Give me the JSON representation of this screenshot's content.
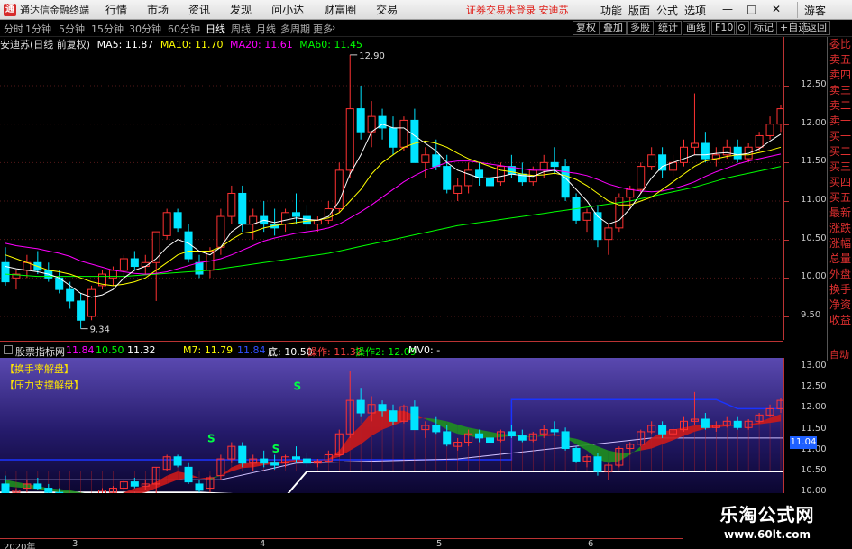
{
  "app": {
    "name": "通达信金融终端",
    "login_text": "证券交易未登录  安迪苏",
    "guest": "游客"
  },
  "menus": [
    "行情",
    "市场",
    "资讯",
    "发现",
    "问小达",
    "财富圈",
    "交易"
  ],
  "right_menus": [
    "功能",
    "版面",
    "公式",
    "选项"
  ],
  "periods": [
    "分时",
    "1分钟",
    "5分钟",
    "15分钟",
    "30分钟",
    "60分钟",
    "日线",
    "周线",
    "月线",
    "多周期",
    "更多"
  ],
  "active_period": "日线",
  "toolbar": [
    "复权",
    "叠加",
    "多股",
    "统计",
    "画线",
    "F10",
    "标记",
    "+自选",
    "返回"
  ],
  "main_header": {
    "stock": "安迪苏(日线 前复权)",
    "ma5": "MA5: 11.87",
    "ma10": "MA10: 11.70",
    "ma20": "MA20: 11.61",
    "ma60": "MA60: 11.45"
  },
  "main_axis": [
    "12.50",
    "12.00",
    "11.50",
    "11.00",
    "10.50",
    "10.00",
    "9.50"
  ],
  "sub_axis": [
    "13.00",
    "12.50",
    "12.00",
    "11.50",
    "11.00",
    "10.50",
    "10.00"
  ],
  "high_label": "12.90",
  "low_label": "9.34",
  "current_value": "11.04",
  "sub_header": {
    "name": "股票指标网",
    "v1": "11.84",
    "v2": "10.50",
    "v3": "11.32",
    "m7": "M7: 11.79",
    "v4": "11.84",
    "di": "底: 10.50",
    "caozuo": "操作: 11.32",
    "caozuo2": "操作2: 12.09",
    "mv": "MV0: -"
  },
  "sub_tags": [
    "【换手率解盘】",
    "【压力支撑解盘】"
  ],
  "right_panel": [
    "委比",
    "卖五",
    "卖四",
    "卖三",
    "卖二",
    "卖一",
    "买一",
    "买二",
    "买三",
    "买四",
    "买五",
    "最新",
    "涨跌",
    "涨幅",
    "总量",
    "外盘",
    "换手",
    "净资",
    "收益"
  ],
  "right_panel_auto": "自动",
  "time_axis": [
    "2020年",
    "3",
    "4",
    "5",
    "6"
  ],
  "watermark": {
    "line1": "乐淘公式网",
    "line2": "www.60lt.com"
  },
  "colors": {
    "up": "#ff3232",
    "down": "#00e4ff",
    "ma5": "#ffffff",
    "ma10": "#ffff00",
    "ma20": "#ff00ff",
    "ma60": "#00ff00"
  },
  "chart_data": {
    "type": "candlestick",
    "title": "安迪苏(日线 前复权)",
    "ylim": [
      9.3,
      12.9
    ],
    "candles": [
      [
        10.2,
        10.4,
        9.9,
        9.95
      ],
      [
        10.0,
        10.1,
        9.85,
        10.05
      ],
      [
        10.1,
        10.3,
        10.0,
        10.2
      ],
      [
        10.2,
        10.35,
        10.05,
        10.1
      ],
      [
        10.1,
        10.2,
        9.95,
        10.0
      ],
      [
        10.0,
        10.1,
        9.8,
        9.85
      ],
      [
        9.85,
        9.95,
        9.6,
        9.7
      ],
      [
        9.7,
        9.8,
        9.34,
        9.45
      ],
      [
        9.5,
        9.9,
        9.45,
        9.85
      ],
      [
        9.9,
        10.1,
        9.85,
        10.05
      ],
      [
        10.0,
        10.15,
        9.9,
        10.1
      ],
      [
        10.1,
        10.3,
        10.0,
        10.25
      ],
      [
        10.25,
        10.35,
        10.1,
        10.15
      ],
      [
        10.15,
        10.3,
        10.05,
        10.2
      ],
      [
        10.2,
        10.6,
        9.7,
        10.6
      ],
      [
        10.55,
        10.9,
        10.5,
        10.85
      ],
      [
        10.85,
        10.9,
        10.6,
        10.65
      ],
      [
        10.6,
        10.7,
        10.2,
        10.25
      ],
      [
        10.2,
        10.3,
        10.0,
        10.05
      ],
      [
        10.1,
        10.4,
        10.0,
        10.35
      ],
      [
        10.4,
        10.9,
        10.3,
        10.8
      ],
      [
        10.8,
        11.2,
        10.7,
        11.1
      ],
      [
        11.1,
        11.2,
        10.6,
        10.7
      ],
      [
        10.7,
        10.9,
        10.5,
        10.8
      ],
      [
        10.8,
        11.0,
        10.6,
        10.7
      ],
      [
        10.7,
        10.9,
        10.55,
        10.65
      ],
      [
        10.7,
        10.9,
        10.6,
        10.85
      ],
      [
        10.85,
        11.1,
        10.7,
        10.8
      ],
      [
        10.8,
        10.95,
        10.6,
        10.7
      ],
      [
        10.7,
        10.8,
        10.6,
        10.75
      ],
      [
        10.75,
        11.0,
        10.7,
        10.9
      ],
      [
        10.9,
        11.5,
        10.85,
        11.4
      ],
      [
        11.4,
        12.9,
        11.3,
        12.2
      ],
      [
        12.2,
        12.5,
        11.8,
        11.9
      ],
      [
        11.9,
        12.3,
        11.7,
        12.1
      ],
      [
        12.1,
        12.2,
        11.8,
        11.95
      ],
      [
        11.95,
        12.1,
        11.6,
        11.7
      ],
      [
        11.7,
        12.1,
        11.65,
        12.05
      ],
      [
        12.05,
        12.2,
        11.5,
        11.5
      ],
      [
        11.5,
        11.7,
        11.3,
        11.6
      ],
      [
        11.6,
        11.8,
        11.4,
        11.45
      ],
      [
        11.45,
        11.6,
        11.1,
        11.15
      ],
      [
        11.1,
        11.3,
        11.0,
        11.2
      ],
      [
        11.2,
        11.5,
        11.1,
        11.4
      ],
      [
        11.4,
        11.5,
        11.2,
        11.3
      ],
      [
        11.3,
        11.45,
        11.15,
        11.2
      ],
      [
        11.25,
        11.5,
        11.2,
        11.45
      ],
      [
        11.45,
        11.6,
        11.3,
        11.35
      ],
      [
        11.35,
        11.5,
        11.2,
        11.25
      ],
      [
        11.25,
        11.45,
        11.2,
        11.4
      ],
      [
        11.4,
        11.6,
        11.3,
        11.5
      ],
      [
        11.5,
        11.7,
        11.35,
        11.45
      ],
      [
        11.45,
        11.55,
        11.0,
        11.05
      ],
      [
        11.05,
        11.1,
        10.7,
        10.75
      ],
      [
        10.75,
        10.9,
        10.6,
        10.85
      ],
      [
        10.85,
        10.95,
        10.4,
        10.5
      ],
      [
        10.5,
        10.7,
        10.3,
        10.65
      ],
      [
        10.65,
        11.1,
        10.6,
        11.05
      ],
      [
        11.05,
        11.2,
        10.9,
        11.15
      ],
      [
        11.15,
        11.5,
        11.1,
        11.45
      ],
      [
        11.45,
        11.7,
        11.4,
        11.6
      ],
      [
        11.6,
        11.7,
        11.3,
        11.4
      ],
      [
        11.4,
        11.6,
        11.3,
        11.5
      ],
      [
        11.5,
        11.8,
        11.45,
        11.7
      ],
      [
        11.7,
        12.4,
        11.6,
        11.75
      ],
      [
        11.75,
        11.9,
        11.5,
        11.55
      ],
      [
        11.55,
        11.7,
        11.45,
        11.6
      ],
      [
        11.6,
        11.8,
        11.55,
        11.7
      ],
      [
        11.7,
        11.8,
        11.5,
        11.55
      ],
      [
        11.55,
        11.75,
        11.5,
        11.7
      ],
      [
        11.7,
        11.9,
        11.65,
        11.85
      ],
      [
        11.85,
        12.1,
        11.8,
        12.0
      ],
      [
        12.0,
        12.25,
        11.9,
        12.2
      ]
    ],
    "ma5": [
      10.15,
      10.12,
      10.1,
      10.08,
      10.05,
      10.0,
      9.9,
      9.8,
      9.75,
      9.78,
      9.85,
      10.0,
      10.1,
      10.15,
      10.25,
      10.4,
      10.5,
      10.45,
      10.35,
      10.3,
      10.4,
      10.6,
      10.7,
      10.7,
      10.75,
      10.72,
      10.75,
      10.78,
      10.76,
      10.75,
      10.8,
      11.0,
      11.35,
      11.6,
      11.9,
      12.0,
      11.95,
      11.95,
      11.85,
      11.75,
      11.65,
      11.5,
      11.4,
      11.35,
      11.3,
      11.3,
      11.32,
      11.35,
      11.33,
      11.32,
      11.38,
      11.4,
      11.3,
      11.15,
      11.0,
      10.8,
      10.7,
      10.75,
      10.9,
      11.1,
      11.3,
      11.45,
      11.5,
      11.55,
      11.6,
      11.6,
      11.62,
      11.63,
      11.6,
      11.62,
      11.68,
      11.78,
      11.87
    ],
    "ma10": [
      10.3,
      10.25,
      10.2,
      10.15,
      10.1,
      10.08,
      10.05,
      10.0,
      9.95,
      9.92,
      9.9,
      9.92,
      9.95,
      10.0,
      10.1,
      10.2,
      10.3,
      10.35,
      10.35,
      10.35,
      10.4,
      10.5,
      10.58,
      10.6,
      10.65,
      10.68,
      10.7,
      10.72,
      10.74,
      10.75,
      10.78,
      10.85,
      11.0,
      11.15,
      11.35,
      11.5,
      11.6,
      11.7,
      11.75,
      11.78,
      11.75,
      11.7,
      11.62,
      11.55,
      11.5,
      11.45,
      11.4,
      11.38,
      11.35,
      11.33,
      11.34,
      11.36,
      11.33,
      11.28,
      11.2,
      11.1,
      11.0,
      10.95,
      10.95,
      11.0,
      11.05,
      11.15,
      11.25,
      11.35,
      11.45,
      11.52,
      11.55,
      11.58,
      11.6,
      11.6,
      11.63,
      11.66,
      11.7
    ],
    "ma20": [
      10.45,
      10.42,
      10.4,
      10.38,
      10.35,
      10.32,
      10.28,
      10.22,
      10.18,
      10.14,
      10.1,
      10.08,
      10.06,
      10.05,
      10.06,
      10.08,
      10.12,
      10.16,
      10.2,
      10.22,
      10.25,
      10.3,
      10.36,
      10.42,
      10.48,
      10.52,
      10.55,
      10.58,
      10.6,
      10.62,
      10.65,
      10.7,
      10.78,
      10.86,
      10.95,
      11.05,
      11.15,
      11.25,
      11.33,
      11.4,
      11.45,
      11.5,
      11.52,
      11.52,
      11.5,
      11.48,
      11.46,
      11.44,
      11.42,
      11.4,
      11.4,
      11.4,
      11.38,
      11.36,
      11.33,
      11.28,
      11.22,
      11.18,
      11.15,
      11.13,
      11.12,
      11.13,
      11.16,
      11.2,
      11.25,
      11.32,
      11.38,
      11.43,
      11.48,
      11.52,
      11.55,
      11.58,
      11.61
    ],
    "ma60": [
      10.05,
      10.04,
      10.03,
      10.02,
      10.02,
      10.02,
      10.02,
      10.02,
      10.02,
      10.02,
      10.02,
      10.02,
      10.03,
      10.04,
      10.05,
      10.06,
      10.07,
      10.08,
      10.09,
      10.1,
      10.12,
      10.14,
      10.16,
      10.18,
      10.2,
      10.22,
      10.24,
      10.26,
      10.28,
      10.3,
      10.32,
      10.35,
      10.38,
      10.41,
      10.44,
      10.47,
      10.5,
      10.53,
      10.56,
      10.59,
      10.62,
      10.65,
      10.68,
      10.7,
      10.72,
      10.74,
      10.76,
      10.78,
      10.8,
      10.82,
      10.84,
      10.86,
      10.88,
      10.9,
      10.92,
      10.94,
      10.96,
      10.98,
      11.0,
      11.03,
      11.06,
      11.09,
      11.12,
      11.15,
      11.18,
      11.22,
      11.26,
      11.3,
      11.33,
      11.36,
      11.39,
      11.42,
      11.45
    ]
  }
}
